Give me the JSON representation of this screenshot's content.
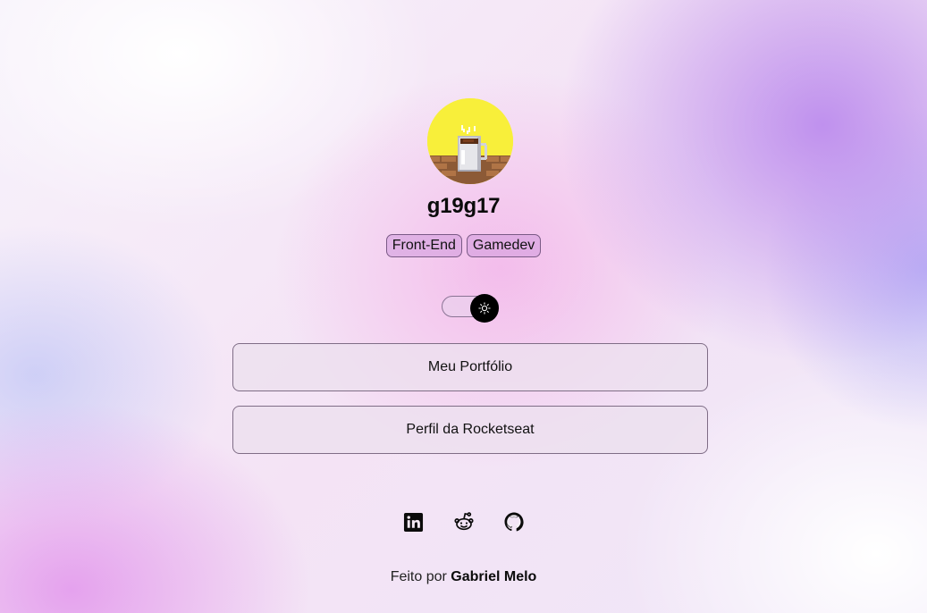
{
  "profile": {
    "username": "g19g17",
    "avatar_icon": "coffee-mug-pixel-art",
    "avatar_bg": "#f8ef3a"
  },
  "tags": [
    "Front-End",
    "Gamedev"
  ],
  "theme_toggle": {
    "icon": "sun-icon",
    "state": "dark"
  },
  "links": {
    "portfolio_label": "Meu Portfólio",
    "rocketseat_label": "Perfil da Rocketseat"
  },
  "socials": [
    {
      "name": "linkedin-icon"
    },
    {
      "name": "reddit-icon"
    },
    {
      "name": "github-icon"
    }
  ],
  "footer": {
    "prefix": "Feito por ",
    "author": "Gabriel Melo"
  },
  "colors": {
    "accent_purple": "#b682ec",
    "accent_pink": "#f3b0e8",
    "tag_bg": "#d09adc"
  }
}
